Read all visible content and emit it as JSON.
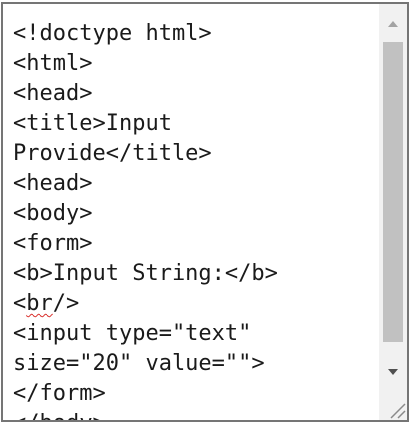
{
  "editor": {
    "lines": [
      "<!doctype html>",
      "<html>",
      "<head>",
      "<title>Input",
      "Provide</title>",
      "<head>",
      "<body>",
      "<form>",
      "<b>Input String:</b>",
      "<br/>",
      "<input type=\"text\"",
      "size=\"20\" value=\"\">",
      "</form>",
      "</body>"
    ],
    "br_open": "<",
    "br_word": "br",
    "br_close": "/>"
  },
  "icons": {
    "scroll_up": "triangle-up",
    "scroll_down": "triangle-down",
    "resize": "diagonal-grip"
  },
  "colors": {
    "border": "#757575",
    "text": "#1a1a1a",
    "scrollbar_track": "#f1f1f1",
    "scrollbar_thumb": "#c1c1c1",
    "spellcheck": "#d9302c"
  }
}
